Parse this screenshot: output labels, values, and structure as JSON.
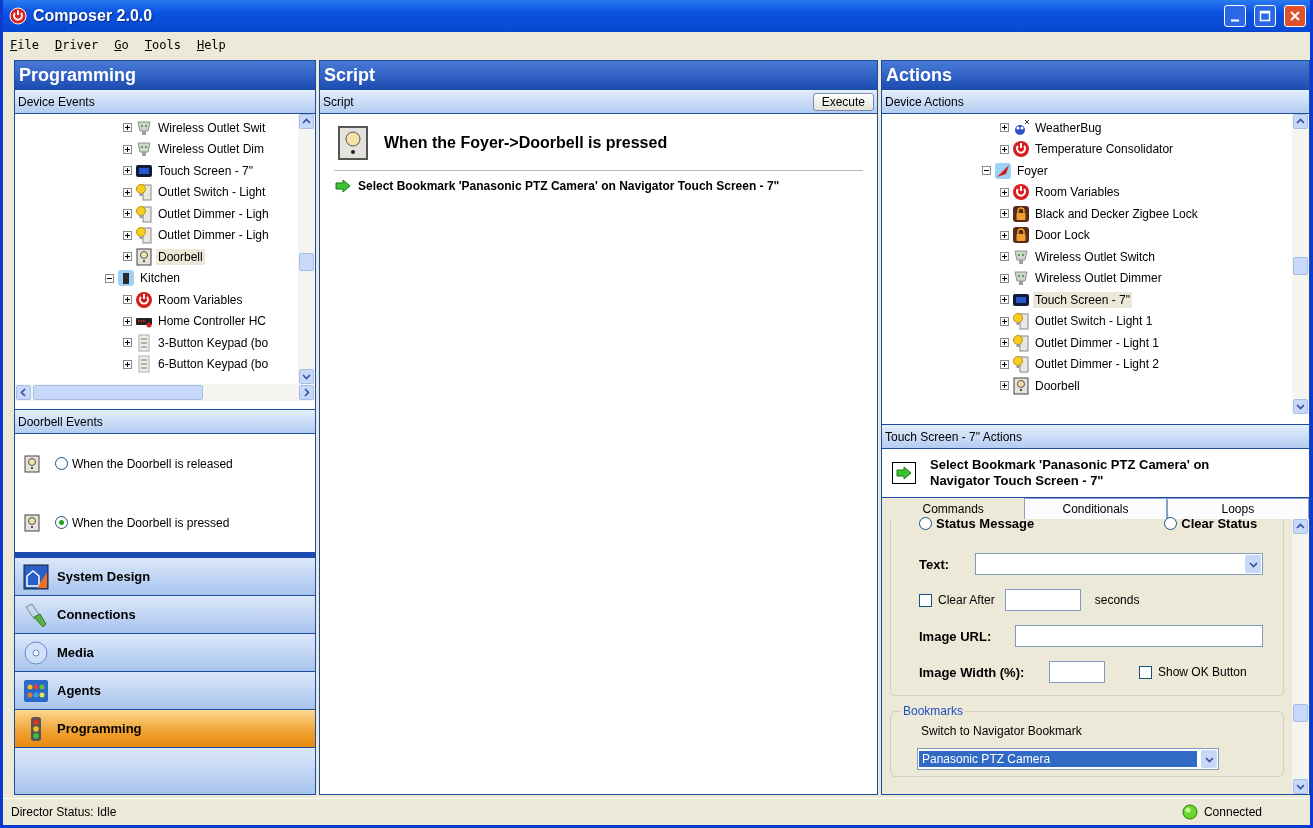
{
  "window": {
    "title": "Composer 2.0.0"
  },
  "menu": [
    "File",
    "Driver",
    "Go",
    "Tools",
    "Help"
  ],
  "programming": {
    "title": "Programming",
    "device_events": {
      "title": "Device Events",
      "tree": [
        {
          "children": [
            {
              "label": "Wireless Outlet Swit",
              "kind": "plug",
              "expanded": false,
              "selected": false
            },
            {
              "label": "Wireless Outlet Dim",
              "kind": "plug",
              "expanded": false,
              "selected": false
            },
            {
              "label": "Touch Screen - 7\"",
              "kind": "screen",
              "expanded": false,
              "selected": false
            },
            {
              "label": "Outlet Switch - Light",
              "kind": "bulb",
              "expanded": false,
              "selected": false
            },
            {
              "label": "Outlet Dimmer - Ligh",
              "kind": "bulb",
              "expanded": false,
              "selected": false
            },
            {
              "label": "Outlet Dimmer - Ligh",
              "kind": "bulb",
              "expanded": false,
              "selected": false
            },
            {
              "label": "Doorbell",
              "kind": "doorbell",
              "expanded": false,
              "selected": true
            }
          ]
        },
        {
          "label": "Kitchen",
          "kind": "room",
          "expanded": true,
          "selected": false,
          "children": [
            {
              "label": "Room Variables",
              "kind": "swirl",
              "expanded": false,
              "selected": false
            },
            {
              "label": "Home Controller HC",
              "kind": "controller",
              "expanded": false,
              "selected": false
            },
            {
              "label": "3-Button Keypad (bo",
              "kind": "keypad",
              "expanded": false,
              "selected": false
            },
            {
              "label": "6-Button Keypad (bo",
              "kind": "keypad",
              "expanded": false,
              "selected": false
            }
          ]
        }
      ]
    },
    "doorbell_events": {
      "title": "Doorbell Events",
      "options": [
        {
          "label": "When the Doorbell is released",
          "selected": false
        },
        {
          "label": "When the Doorbell is pressed",
          "selected": true
        }
      ]
    }
  },
  "nav": [
    {
      "label": "System Design",
      "kind": "design",
      "selected": false
    },
    {
      "label": "Connections",
      "kind": "connections",
      "selected": false
    },
    {
      "label": "Media",
      "kind": "media",
      "selected": false
    },
    {
      "label": "Agents",
      "kind": "agents",
      "selected": false
    },
    {
      "label": "Programming",
      "kind": "programming",
      "selected": true
    }
  ],
  "script": {
    "title": "Script",
    "subtitle": "Script",
    "execute": "Execute",
    "event": "When the Foyer->Doorbell is pressed",
    "actions": [
      "Select Bookmark 'Panasonic PTZ Camera' on Navigator Touch Screen - 7\""
    ]
  },
  "actions": {
    "title": "Actions",
    "device_actions": {
      "title": "Device Actions",
      "tree": [
        {
          "children": [
            {
              "label": "WeatherBug",
              "kind": "bug",
              "expanded": false,
              "selected": false
            },
            {
              "label": "Temperature Consolidator",
              "kind": "swirl",
              "expanded": false,
              "selected": false
            }
          ]
        },
        {
          "label": "Foyer",
          "kind": "foyer",
          "expanded": true,
          "selected": false,
          "children": [
            {
              "label": "Room Variables",
              "kind": "swirl",
              "expanded": false,
              "selected": false
            },
            {
              "label": "Black and Decker Zigbee Lock",
              "kind": "lock",
              "expanded": false,
              "selected": false
            },
            {
              "label": "Door Lock",
              "kind": "lock",
              "expanded": false,
              "selected": false
            },
            {
              "label": "Wireless Outlet Switch",
              "kind": "plug",
              "expanded": false,
              "selected": false
            },
            {
              "label": "Wireless Outlet Dimmer",
              "kind": "plug",
              "expanded": false,
              "selected": false
            },
            {
              "label": "Touch Screen - 7\"",
              "kind": "screen",
              "expanded": false,
              "selected": true
            },
            {
              "label": "Outlet Switch - Light 1",
              "kind": "bulb",
              "expanded": false,
              "selected": false
            },
            {
              "label": "Outlet Dimmer - Light 1",
              "kind": "bulb",
              "expanded": false,
              "selected": false
            },
            {
              "label": "Outlet Dimmer - Light 2",
              "kind": "bulb",
              "expanded": false,
              "selected": false
            },
            {
              "label": "Doorbell",
              "kind": "doorbell",
              "expanded": false,
              "selected": false
            }
          ]
        }
      ]
    },
    "command_panel": {
      "title": "Touch Screen - 7\" Actions",
      "summary": "Select Bookmark 'Panasonic PTZ Camera' on Navigator Touch Screen - 7\"",
      "tabs": [
        {
          "label": "Commands",
          "selected": true
        },
        {
          "label": "Conditionals",
          "selected": false
        },
        {
          "label": "Loops",
          "selected": false
        }
      ],
      "form": {
        "status_options": [
          {
            "label": "Status Message",
            "selected": false
          },
          {
            "label": "Clear Status",
            "selected": false
          }
        ],
        "text_label": "Text:",
        "clear_after": {
          "label": "Clear After",
          "checked": false,
          "unit": "seconds"
        },
        "image_url_label": "Image URL:",
        "image_width_label": "Image Width (%):",
        "show_ok": {
          "label": "Show OK Button",
          "checked": false
        },
        "bookmarks": {
          "legend": "Bookmarks",
          "label": "Switch to Navigator Bookmark",
          "value": "Panasonic PTZ Camera"
        }
      }
    }
  },
  "status_bar": {
    "status": "Director Status: Idle",
    "connection": "Connected"
  }
}
